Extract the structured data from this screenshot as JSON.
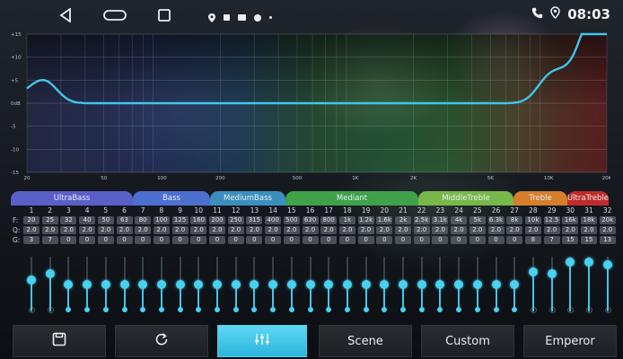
{
  "status_bar": {
    "time": "08:03",
    "nav": [
      "back",
      "home",
      "recents"
    ],
    "icons": [
      "location-icon",
      "sim-icon",
      "media-icon",
      "circle-icon",
      "dot-icon"
    ]
  },
  "graph": {
    "y_ticks": [
      "+15",
      "+10",
      "+5",
      "0dB",
      "-5",
      "-10",
      "-15"
    ],
    "x_ticks": [
      "20",
      "50",
      "100",
      "200",
      "500",
      "1K",
      "2K",
      "5K",
      "10K",
      "20K"
    ],
    "curve_color": "#3fc6ea"
  },
  "bands": [
    {
      "label": "UltraBass",
      "color": "#5a5fc8"
    },
    {
      "label": "Bass",
      "color": "#4c6fd0"
    },
    {
      "label": "MediumBass",
      "color": "#3b8fbf"
    },
    {
      "label": "Mediant",
      "color": "#3fa24a"
    },
    {
      "label": "MiddleTreble",
      "color": "#78b84a"
    },
    {
      "label": "Treble",
      "color": "#d67e2a"
    },
    {
      "label": "UltraTreble",
      "color": "#c02a2a"
    }
  ],
  "eq": {
    "row_labels": [
      "F:",
      "Q:",
      "G:"
    ],
    "channels": [
      "1",
      "2",
      "3",
      "4",
      "5",
      "6",
      "7",
      "8",
      "9",
      "10",
      "11",
      "12",
      "13",
      "14",
      "15",
      "16",
      "17",
      "18",
      "19",
      "20",
      "21",
      "22",
      "23",
      "24",
      "25",
      "26",
      "27",
      "28",
      "29",
      "30",
      "31",
      "32"
    ],
    "freq": [
      "20",
      "25",
      "32",
      "40",
      "50",
      "63",
      "80",
      "100",
      "125",
      "160",
      "200",
      "250",
      "315",
      "400",
      "500",
      "630",
      "800",
      "1k",
      "1.2k",
      "1.6k",
      "2k",
      "2.5k",
      "3.1k",
      "4k",
      "5k",
      "6.3k",
      "8k",
      "10k",
      "12.5",
      "16k",
      "18k",
      "20k"
    ],
    "q": [
      "2.0",
      "2.0",
      "2.0",
      "2.0",
      "2.0",
      "2.0",
      "2.0",
      "2.0",
      "2.0",
      "2.0",
      "2.0",
      "2.0",
      "2.0",
      "2.0",
      "2.0",
      "2.0",
      "2.0",
      "2.0",
      "2.0",
      "2.0",
      "2.0",
      "2.0",
      "2.0",
      "2.0",
      "2.0",
      "2.0",
      "2.0",
      "2.0",
      "2.0",
      "2.0",
      "2.0",
      "2.0"
    ],
    "gain": [
      "3",
      "7",
      "0",
      "0",
      "0",
      "0",
      "0",
      "0",
      "0",
      "0",
      "0",
      "0",
      "0",
      "0",
      "0",
      "0",
      "0",
      "0",
      "0",
      "0",
      "0",
      "0",
      "0",
      "0",
      "0",
      "0",
      "0",
      "8",
      "7",
      "15",
      "15",
      "13"
    ]
  },
  "toolbar": {
    "save_icon": "save-icon",
    "reset_icon": "reset-icon",
    "eq_icon": "equalizer-icon",
    "scene_label": "Scene",
    "custom_label": "Custom",
    "emperor_label": "Emperor",
    "accent": "#3ec8ea"
  }
}
